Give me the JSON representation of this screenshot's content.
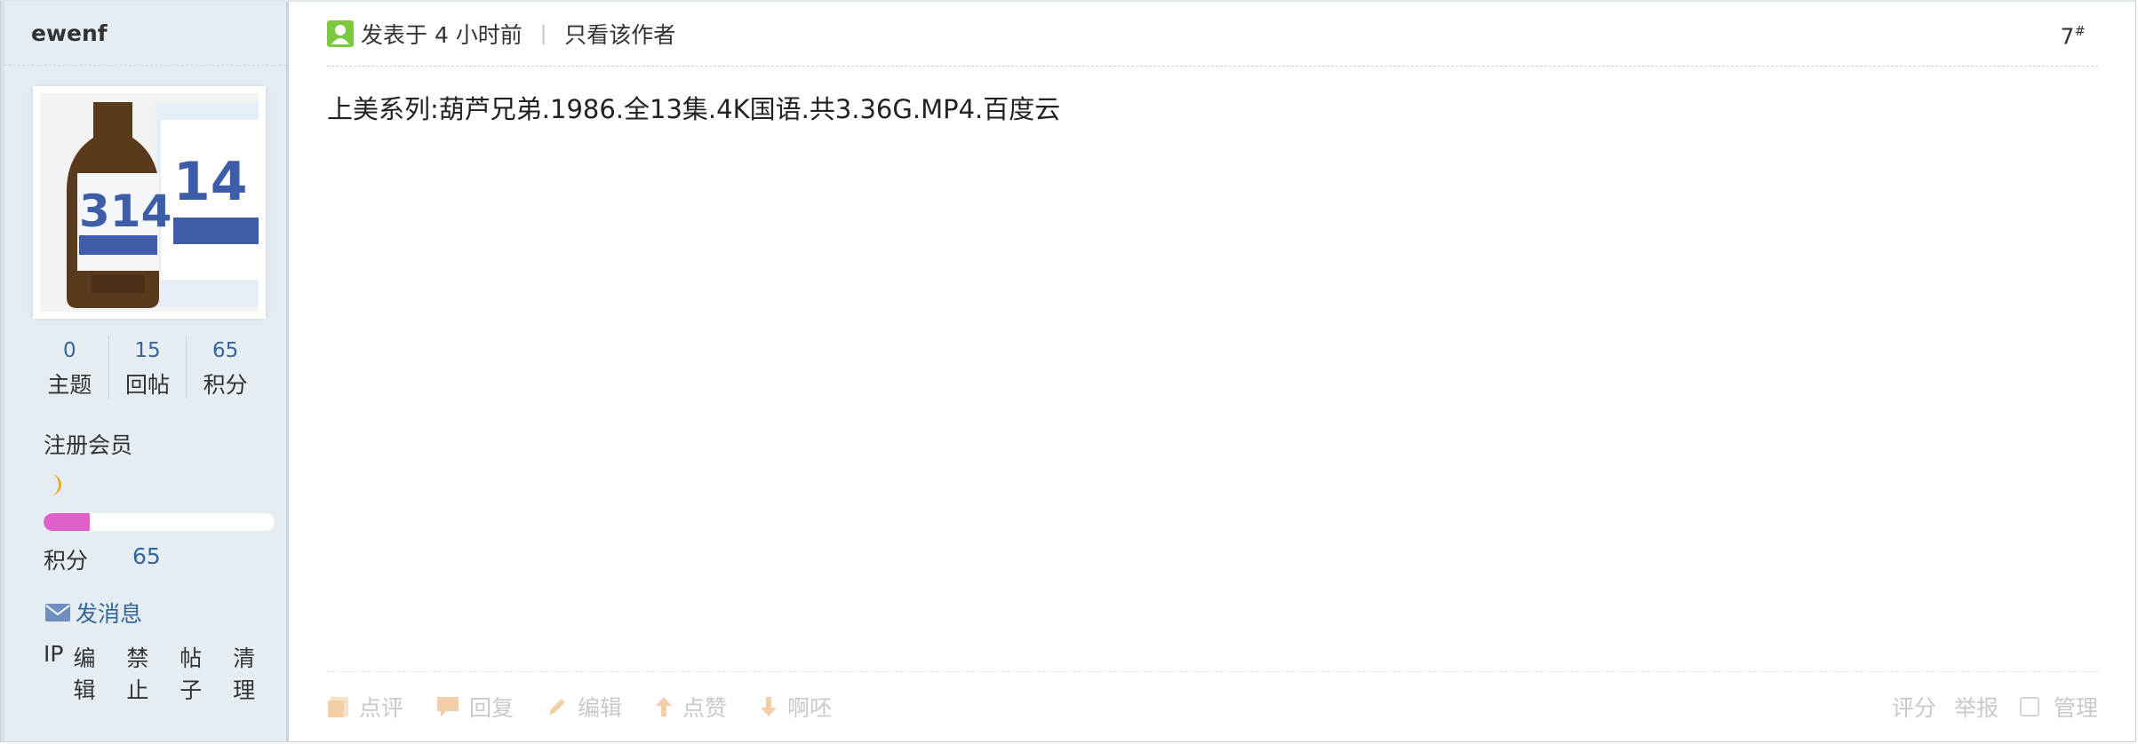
{
  "author": {
    "name": "ewenf"
  },
  "stats": [
    {
      "value": "0",
      "label": "主题"
    },
    {
      "value": "15",
      "label": "回帖"
    },
    {
      "value": "65",
      "label": "积分"
    }
  ],
  "user_group": "注册会员",
  "level_progress": 0.2,
  "credits": {
    "label": "积分",
    "value": "65"
  },
  "send_message": "发消息",
  "admin_links": [
    "IP",
    "编辑",
    "禁止",
    "帖子",
    "清理"
  ],
  "post": {
    "posted_time": "发表于 4 小时前",
    "only_author": "只看该作者",
    "floor": "7",
    "floor_mark": "#",
    "content": "上美系列:葫芦兄弟.1986.全13集.4K国语.共3.36G.MP4.百度云"
  },
  "actions": {
    "comment": "点评",
    "reply": "回复",
    "edit": "编辑",
    "like": "点赞",
    "dislike": "啊呸",
    "rate": "评分",
    "report": "举报",
    "manage": "管理"
  },
  "colors": {
    "progress_fill": "#dc62c9",
    "link": "#336699",
    "moon": "#f5a623"
  }
}
